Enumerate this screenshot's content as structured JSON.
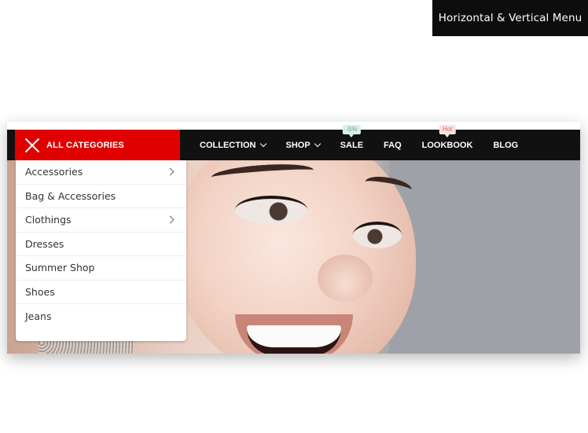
{
  "corner_label": "Horizontal & Vertical Menu",
  "category_button": {
    "label": "ALL CATEGORIES",
    "icon": "close-icon",
    "color": "#e00000"
  },
  "top_menu": [
    {
      "label": "COLLECTION",
      "has_dropdown": true,
      "badge": ""
    },
    {
      "label": "SHOP",
      "has_dropdown": true,
      "badge": ""
    },
    {
      "label": "SALE",
      "has_dropdown": false,
      "badge": "-5%"
    },
    {
      "label": "FAQ",
      "has_dropdown": false,
      "badge": ""
    },
    {
      "label": "LOOKBOOK",
      "has_dropdown": false,
      "badge": "Hot"
    },
    {
      "label": "BLOG",
      "has_dropdown": false,
      "badge": ""
    }
  ],
  "categories": [
    {
      "label": "Accessories",
      "has_submenu": true
    },
    {
      "label": "Bag & Accessories",
      "has_submenu": false
    },
    {
      "label": "Clothings",
      "has_submenu": true
    },
    {
      "label": "Dresses",
      "has_submenu": false
    },
    {
      "label": "Summer Shop",
      "has_submenu": false
    },
    {
      "label": "Shoes",
      "has_submenu": false
    },
    {
      "label": "Jeans",
      "has_submenu": false
    }
  ],
  "colors": {
    "navbar": "#111111",
    "accent": "#e00000",
    "sale_badge": "#d7f0ea",
    "hot_badge": "#fbe1e1"
  }
}
